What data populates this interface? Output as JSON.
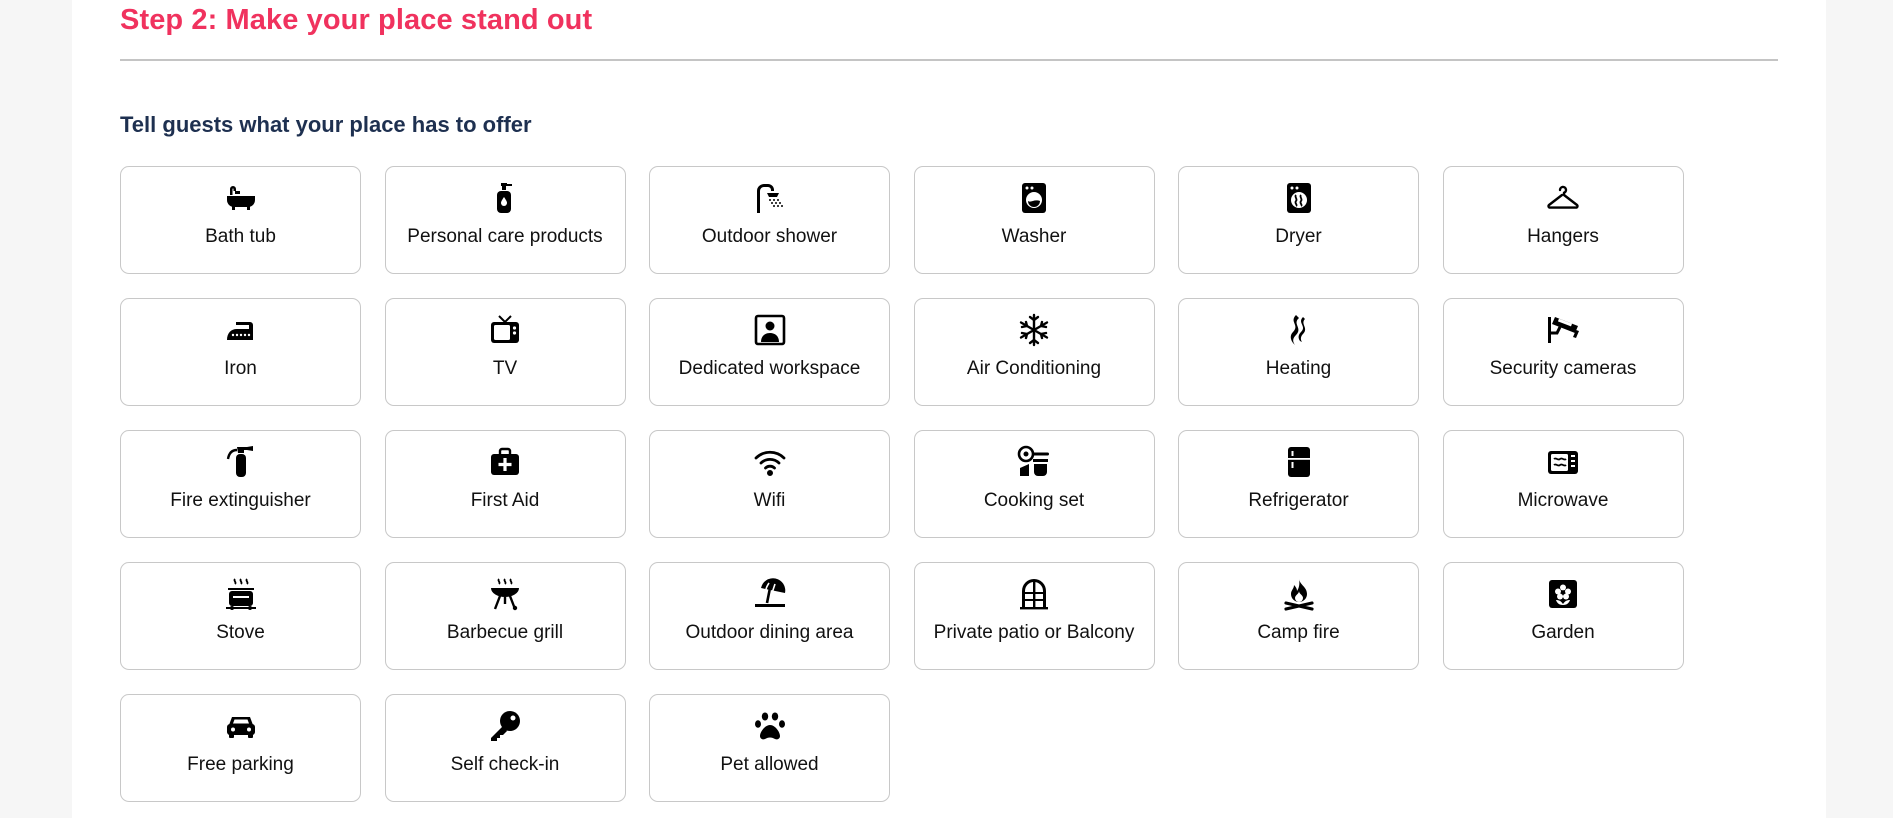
{
  "step_title": "Step 2: Make your place stand out",
  "subtitle": "Tell guests what your place has to offer",
  "amenities": [
    {
      "label": "Bath tub",
      "icon": "bathtub-icon"
    },
    {
      "label": "Personal care products",
      "icon": "soap-bottle-icon"
    },
    {
      "label": "Outdoor shower",
      "icon": "shower-icon"
    },
    {
      "label": "Washer",
      "icon": "washer-icon"
    },
    {
      "label": "Dryer",
      "icon": "dryer-icon"
    },
    {
      "label": "Hangers",
      "icon": "hanger-icon"
    },
    {
      "label": "Iron",
      "icon": "iron-icon"
    },
    {
      "label": "TV",
      "icon": "tv-icon"
    },
    {
      "label": "Dedicated workspace",
      "icon": "workspace-icon"
    },
    {
      "label": "Air Conditioning",
      "icon": "snowflake-icon"
    },
    {
      "label": "Heating",
      "icon": "heat-waves-icon"
    },
    {
      "label": "Security cameras",
      "icon": "security-camera-icon"
    },
    {
      "label": "Fire extinguisher",
      "icon": "fire-extinguisher-icon"
    },
    {
      "label": "First Aid",
      "icon": "first-aid-kit-icon"
    },
    {
      "label": "Wifi",
      "icon": "wifi-icon"
    },
    {
      "label": "Cooking set",
      "icon": "cooking-set-icon"
    },
    {
      "label": "Refrigerator",
      "icon": "refrigerator-icon"
    },
    {
      "label": "Microwave",
      "icon": "microwave-icon"
    },
    {
      "label": "Stove",
      "icon": "stove-icon"
    },
    {
      "label": "Barbecue grill",
      "icon": "grill-icon"
    },
    {
      "label": "Outdoor dining area",
      "icon": "beach-umbrella-icon"
    },
    {
      "label": "Private patio or Balcony",
      "icon": "patio-door-icon"
    },
    {
      "label": "Camp fire",
      "icon": "campfire-icon"
    },
    {
      "label": "Garden",
      "icon": "garden-flower-icon"
    },
    {
      "label": "Free parking",
      "icon": "car-icon"
    },
    {
      "label": "Self check-in",
      "icon": "key-icon"
    },
    {
      "label": "Pet allowed",
      "icon": "paw-icon"
    }
  ]
}
